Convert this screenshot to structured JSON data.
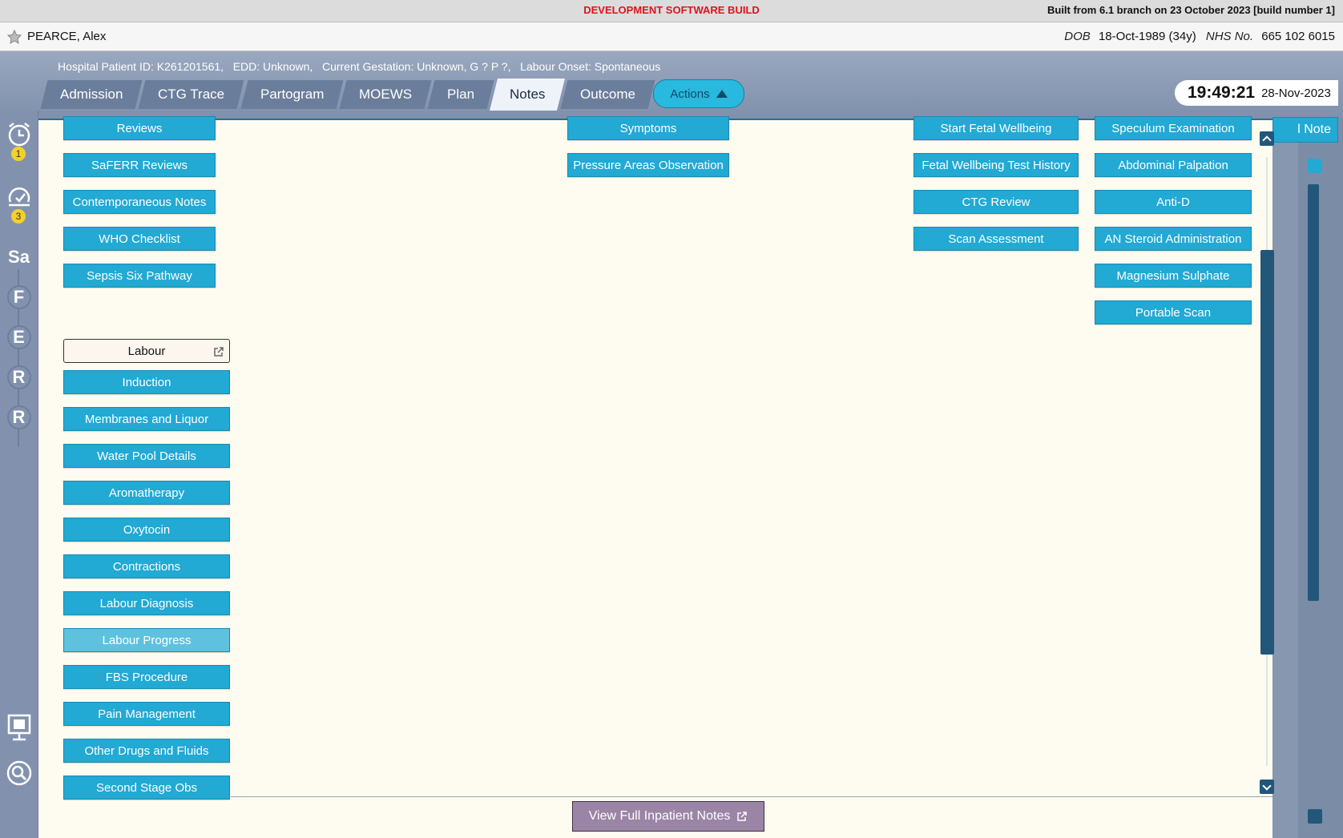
{
  "banner": {
    "dev_text": "DEVELOPMENT SOFTWARE BUILD",
    "build_text": "Built from 6.1 branch on 23 October 2023 [build number 1]"
  },
  "patient": {
    "name": "PEARCE, Alex",
    "dob_label": "DOB",
    "dob_value": "18-Oct-1989 (34y)",
    "nhs_label": "NHS No.",
    "nhs_value": "665 102 6015",
    "info_line": "Hospital Patient ID: K261201561,   EDD: Unknown,   Current Gestation: Unknown, G ? P ?,   Labour Onset: Spontaneous"
  },
  "tabs": [
    "Admission",
    "CTG Trace",
    "Partogram",
    "MOEWS",
    "Plan",
    "Notes",
    "Outcome"
  ],
  "active_tab": "Notes",
  "actions_label": "Actions",
  "clock": {
    "time": "19:49:21",
    "date": "28-Nov-2023"
  },
  "sidebar": {
    "badge_alarm": "1",
    "badge_timer": "3",
    "letters": [
      "Sa",
      "F",
      "E",
      "R",
      "R"
    ]
  },
  "add_note_label": "l Note",
  "column1_top": [
    "Reviews",
    "SaFERR Reviews",
    "Contemporaneous Notes",
    "WHO Checklist",
    "Sepsis Six Pathway"
  ],
  "labour_section": {
    "header": "Labour",
    "items": [
      "Induction",
      "Membranes and Liquor",
      "Water Pool Details",
      "Aromatherapy",
      "Oxytocin",
      "Contractions",
      "Labour Diagnosis",
      "Labour Progress",
      "FBS Procedure",
      "Pain Management",
      "Other Drugs and Fluids",
      "Second Stage Obs"
    ]
  },
  "column2": [
    "Symptoms",
    "Pressure Areas Observation"
  ],
  "column3": [
    "Start Fetal Wellbeing",
    "Fetal Wellbeing Test History",
    "CTG Review",
    "Scan Assessment"
  ],
  "column4": [
    "Speculum Examination",
    "Abdominal Palpation",
    "Anti-D",
    "AN Steroid Administration",
    "Magnesium Sulphate",
    "Portable Scan"
  ],
  "view_full_label": "View Full Inpatient Notes",
  "colors": {
    "button": "#22a9d4",
    "active_tab": "#eef3fa",
    "dev_text": "#e0131b",
    "scroll": "#22577a"
  }
}
